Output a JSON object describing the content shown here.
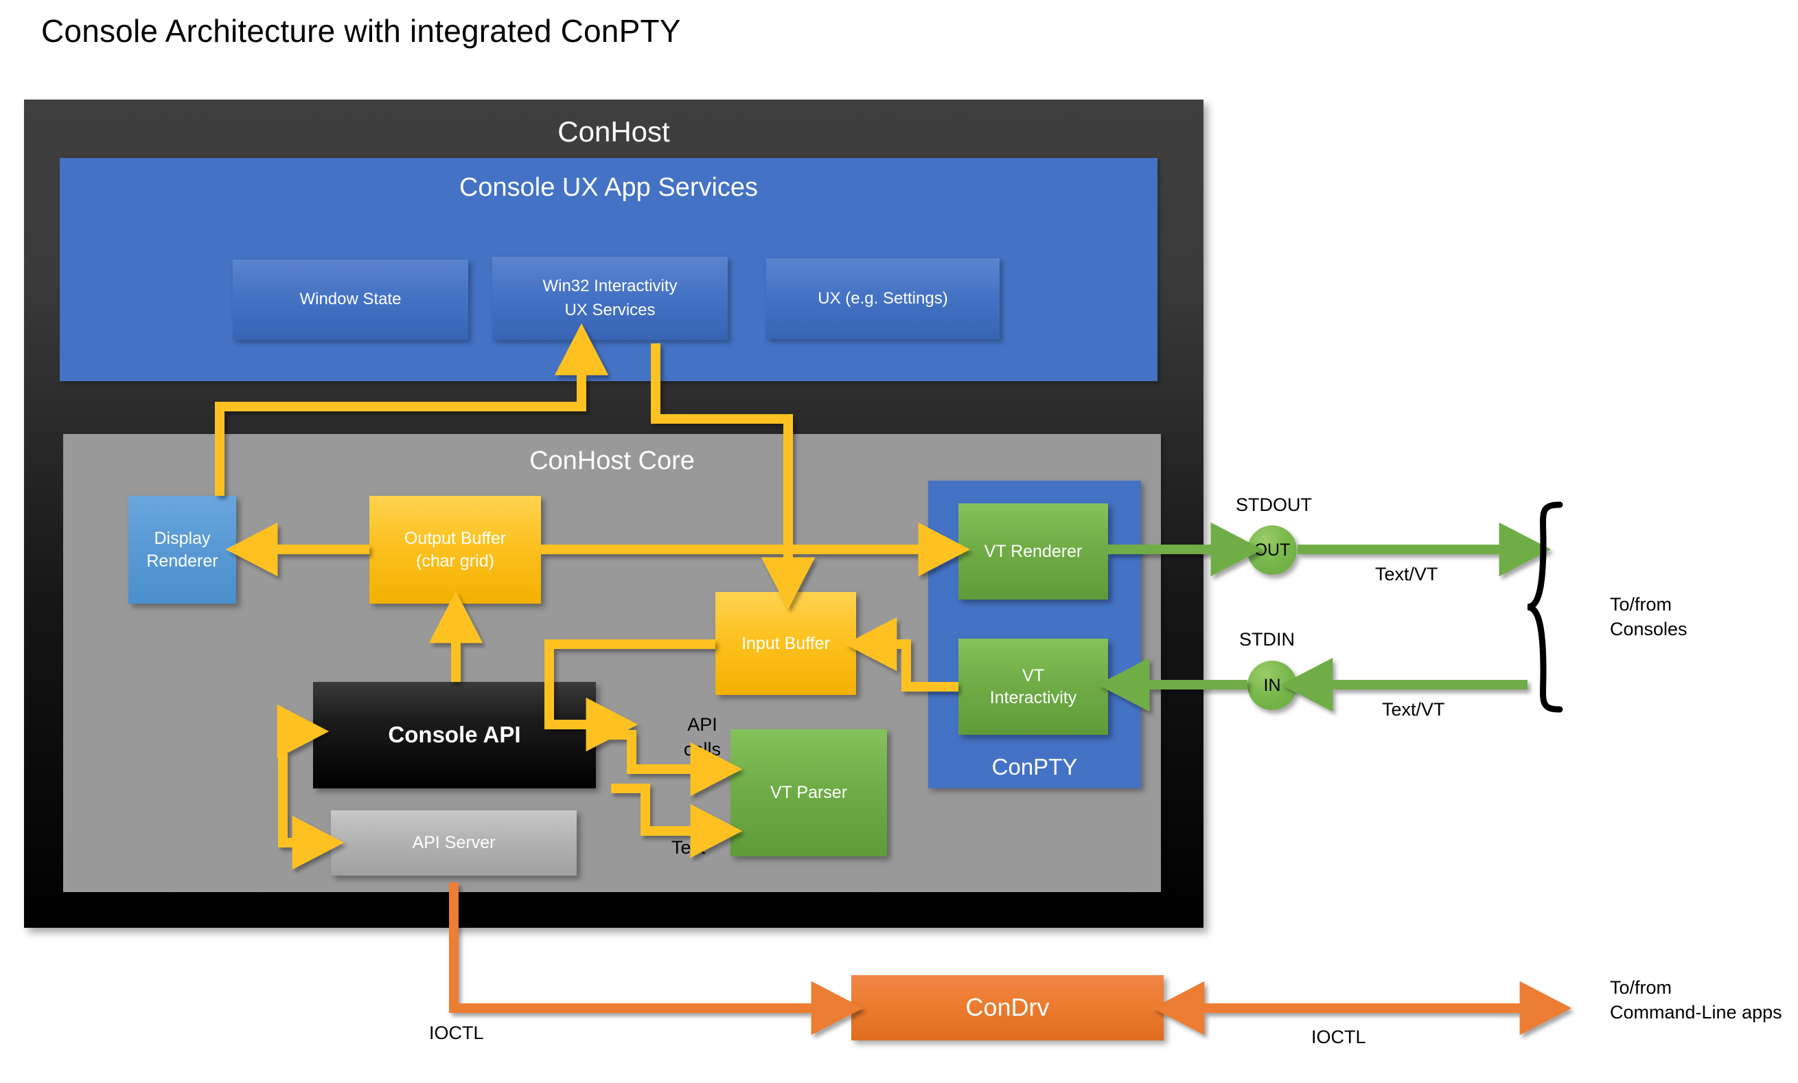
{
  "title": "Console Architecture with integrated ConPTY",
  "colors": {
    "conhost_bg": "#2b2b2b",
    "ux_blue": "#4472c4",
    "core_gray": "#999999",
    "yellow": "#fdc221",
    "green": "#70ad47",
    "orange": "#ed7d31",
    "light_blue": "#5b9bd5",
    "black": "#000000",
    "api_server_gray": "#b3b3b3",
    "white": "#ffffff"
  },
  "conhost": {
    "title": "ConHost",
    "ux_panel": {
      "title": "Console UX App Services",
      "boxes": [
        {
          "label": "Window State"
        },
        {
          "label": "Win32 Interactivity\nUX Services"
        },
        {
          "label": "UX (e.g. Settings)"
        }
      ]
    },
    "core_panel": {
      "title": "ConHost Core",
      "boxes": [
        {
          "label": "Display\nRenderer",
          "color": "#5b9bd5"
        },
        {
          "label": "Output Buffer\n(char grid)",
          "color": "#fdc221"
        },
        {
          "label": "Input Buffer",
          "color": "#fdc221"
        },
        {
          "label": "Console API",
          "color": "#000000"
        },
        {
          "label": "API Server",
          "color": "#b3b3b3"
        },
        {
          "label": "VT Parser",
          "color": "#70ad47"
        }
      ],
      "conpty": {
        "title": "ConPTY",
        "boxes": [
          {
            "label": "VT Renderer",
            "color": "#70ad47"
          },
          {
            "label": "VT\nInteractivity",
            "color": "#70ad47"
          }
        ]
      }
    }
  },
  "condrv": {
    "label": "ConDrv"
  },
  "io": {
    "stdout_label": "STDOUT",
    "stdin_label": "STDIN",
    "out_circle": "OUT",
    "in_circle": "IN",
    "textvt_out": "Text/VT",
    "textvt_in": "Text/VT",
    "tofrom_consoles": "To/from\nConsoles"
  },
  "edge_labels": {
    "api_calls": "API\ncalls",
    "text": "Text",
    "ioctl_left": "IOCTL",
    "ioctl_right": "IOCTL",
    "tofrom_cli": "To/from\nCommand-Line apps"
  }
}
